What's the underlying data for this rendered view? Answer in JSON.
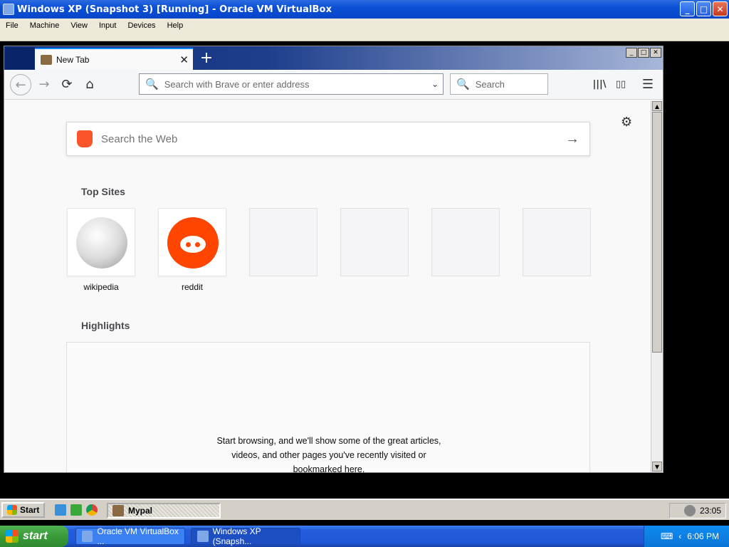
{
  "vbox": {
    "title": "Windows XP (Snapshot 3) [Running] - Oracle VM VirtualBox",
    "menu": [
      "File",
      "Machine",
      "View",
      "Input",
      "Devices",
      "Help"
    ],
    "window_buttons": {
      "minimize": "_",
      "maximize": "□",
      "close": "✕"
    }
  },
  "browser": {
    "tab": {
      "label": "New Tab",
      "close": "✕"
    },
    "new_tab_icon": "+",
    "window_buttons": {
      "minimize": "_",
      "maximize": "□",
      "close": "✕"
    },
    "nav_icons": {
      "back": "←",
      "forward": "→",
      "reload": "⟳",
      "home": "⌂",
      "library": "|||\\",
      "sidebar": "▯▯",
      "menu": "☰"
    },
    "urlbar": {
      "placeholder": "Search with Brave or enter address",
      "dropdown_icon": "⌄",
      "search_icon": "🔍"
    },
    "searchbar": {
      "placeholder": "Search"
    }
  },
  "newtab": {
    "settings_icon": "⚙",
    "web_search": {
      "placeholder": "Search the Web",
      "go_icon": "→"
    },
    "top_sites_title": "Top Sites",
    "top_sites": [
      {
        "label": "wikipedia",
        "icon": "wikipedia-globe-icon"
      },
      {
        "label": "reddit",
        "icon": "reddit-alien-icon"
      }
    ],
    "highlights_title": "Highlights",
    "highlights_message": "Start browsing, and we'll show some of the great articles,\nvideos, and other pages you've recently visited or\nbookmarked here."
  },
  "guest_taskbar": {
    "start_label": "Start",
    "task_label": "Mypal",
    "clock": "23:05"
  },
  "host_taskbar": {
    "start_label": "start",
    "tasks": [
      "Oracle VM VirtualBox ...",
      "Windows XP (Snapsh..."
    ],
    "clock": "6:06 PM"
  }
}
